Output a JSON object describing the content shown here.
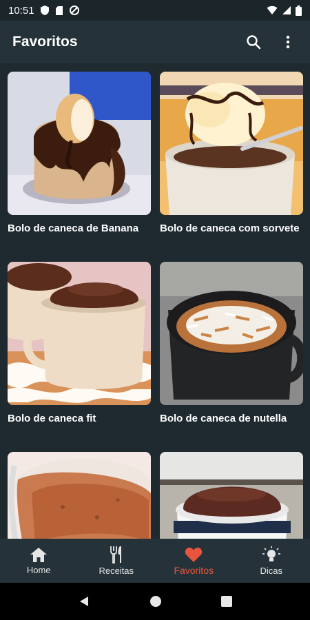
{
  "status_bar": {
    "time": "10:51"
  },
  "app_bar": {
    "title": "Favoritos",
    "search_icon": "search-icon",
    "more_icon": "more-vert-icon"
  },
  "recipes": [
    {
      "title": "Bolo de caneca de Banana"
    },
    {
      "title": "Bolo de caneca com sorvete"
    },
    {
      "title": "Bolo de caneca fit"
    },
    {
      "title": "Bolo de caneca de nutella"
    },
    {
      "title": ""
    },
    {
      "title": ""
    }
  ],
  "bottom_nav": {
    "items": [
      {
        "label": "Home",
        "icon": "home-icon"
      },
      {
        "label": "Receitas",
        "icon": "fork-knife-icon"
      },
      {
        "label": "Favoritos",
        "icon": "heart-icon"
      },
      {
        "label": "Dicas",
        "icon": "lightbulb-icon"
      }
    ],
    "active_color": "#e8553d"
  }
}
